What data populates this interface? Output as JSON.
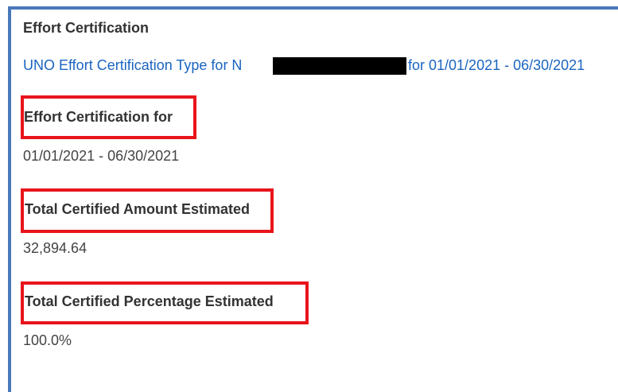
{
  "card": {
    "title": "Effort Certification",
    "link": {
      "prefix": "UNO Effort Certification Type for N",
      "suffix": "for 01/01/2021 - 06/30/2021"
    }
  },
  "fields": [
    {
      "label": "Effort Certification for",
      "value": "01/01/2021 - 06/30/2021"
    },
    {
      "label": "Total Certified Amount Estimated",
      "value": "32,894.64"
    },
    {
      "label": "Total Certified Percentage Estimated",
      "value": "100.0%"
    }
  ],
  "colors": {
    "frame_border": "#4a78b8",
    "link": "#1a65c0",
    "highlight": "#e8141c",
    "redaction": "#000000"
  }
}
